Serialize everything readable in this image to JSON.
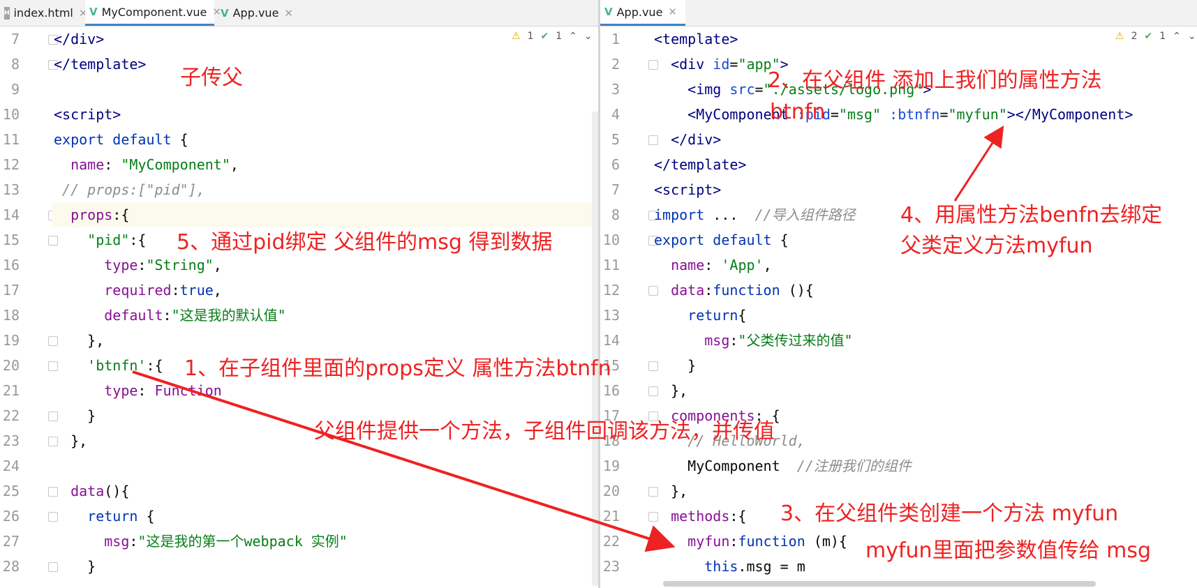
{
  "left": {
    "tabs": [
      {
        "label": "index.html",
        "icon": "html-file-icon",
        "active": false
      },
      {
        "label": "MyComponent.vue",
        "icon": "vue-file-icon",
        "active": true
      },
      {
        "label": "App.vue",
        "icon": "vue-file-icon",
        "active": false
      }
    ],
    "status": {
      "warnings": "1",
      "ok": "1"
    },
    "lines": [
      {
        "n": "7",
        "tokens": [
          [
            "tag",
            "</div>"
          ]
        ]
      },
      {
        "n": "8",
        "tokens": [
          [
            "tag",
            "</template>"
          ]
        ]
      },
      {
        "n": "9",
        "tokens": []
      },
      {
        "n": "10",
        "tokens": [
          [
            "tag",
            "<script>"
          ]
        ]
      },
      {
        "n": "11",
        "tokens": [
          [
            "kw",
            "export default "
          ],
          [
            "plain",
            "{"
          ]
        ]
      },
      {
        "n": "12",
        "tokens": [
          [
            "plain",
            "  "
          ],
          [
            "prop",
            "name"
          ],
          [
            "plain",
            ": "
          ],
          [
            "str",
            "\"MyComponent\""
          ],
          [
            "plain",
            ","
          ]
        ]
      },
      {
        "n": "13",
        "tokens": [
          [
            "cmt",
            " // props:[\"pid\"],"
          ]
        ]
      },
      {
        "n": "14",
        "tokens": [
          [
            "plain",
            "  "
          ],
          [
            "prop",
            "props"
          ],
          [
            "plain",
            ":{"
          ]
        ]
      },
      {
        "n": "15",
        "tokens": [
          [
            "plain",
            "    "
          ],
          [
            "str",
            "\"pid\""
          ],
          [
            "plain",
            ":{"
          ]
        ]
      },
      {
        "n": "16",
        "tokens": [
          [
            "plain",
            "      "
          ],
          [
            "prop",
            "type"
          ],
          [
            "plain",
            ":"
          ],
          [
            "str",
            "\"String\""
          ],
          [
            "plain",
            ","
          ]
        ]
      },
      {
        "n": "17",
        "tokens": [
          [
            "plain",
            "      "
          ],
          [
            "prop",
            "required"
          ],
          [
            "plain",
            ":"
          ],
          [
            "kw",
            "true"
          ],
          [
            "plain",
            ","
          ]
        ]
      },
      {
        "n": "18",
        "tokens": [
          [
            "plain",
            "      "
          ],
          [
            "prop",
            "default"
          ],
          [
            "plain",
            ":"
          ],
          [
            "str",
            "\"这是我的默认值\""
          ]
        ]
      },
      {
        "n": "19",
        "tokens": [
          [
            "plain",
            "    },"
          ]
        ]
      },
      {
        "n": "20",
        "tokens": [
          [
            "plain",
            "    "
          ],
          [
            "str",
            "'btnfn'"
          ],
          [
            "plain",
            ":{"
          ]
        ]
      },
      {
        "n": "21",
        "tokens": [
          [
            "plain",
            "      "
          ],
          [
            "prop",
            "type"
          ],
          [
            "plain",
            ": "
          ],
          [
            "prop",
            "Function"
          ]
        ]
      },
      {
        "n": "22",
        "tokens": [
          [
            "plain",
            "    }"
          ]
        ]
      },
      {
        "n": "23",
        "tokens": [
          [
            "plain",
            "  },"
          ]
        ]
      },
      {
        "n": "24",
        "tokens": []
      },
      {
        "n": "25",
        "tokens": [
          [
            "plain",
            "  "
          ],
          [
            "prop",
            "data"
          ],
          [
            "plain",
            "(){"
          ]
        ]
      },
      {
        "n": "26",
        "tokens": [
          [
            "plain",
            "    "
          ],
          [
            "kw",
            "return "
          ],
          [
            "plain",
            "{"
          ]
        ]
      },
      {
        "n": "27",
        "tokens": [
          [
            "plain",
            "      "
          ],
          [
            "prop",
            "msg"
          ],
          [
            "plain",
            ":"
          ],
          [
            "str",
            "\"这是我的第一个webpack 实例\""
          ]
        ]
      },
      {
        "n": "28",
        "tokens": [
          [
            "plain",
            "    }"
          ]
        ]
      }
    ]
  },
  "right": {
    "tabs": [
      {
        "label": "App.vue",
        "icon": "vue-file-icon",
        "active": true
      }
    ],
    "status": {
      "warnings": "2",
      "ok": "1"
    },
    "lines": [
      {
        "n": "1",
        "tokens": [
          [
            "tag",
            "<template>"
          ]
        ]
      },
      {
        "n": "2",
        "tokens": [
          [
            "tag",
            "  <div "
          ],
          [
            "attr",
            "id"
          ],
          [
            "plain",
            "="
          ],
          [
            "str",
            "\"app\""
          ],
          [
            "tag",
            ">"
          ]
        ]
      },
      {
        "n": "3",
        "tokens": [
          [
            "tag",
            "    <img "
          ],
          [
            "attr",
            "src"
          ],
          [
            "plain",
            "="
          ],
          [
            "str",
            "\"./assets/logo.png\""
          ],
          [
            "tag",
            ">"
          ]
        ]
      },
      {
        "n": "4",
        "tokens": [
          [
            "tag",
            "    <MyComponent "
          ],
          [
            "attr",
            ":pid"
          ],
          [
            "plain",
            "="
          ],
          [
            "str",
            "\"msg\""
          ],
          [
            "attr",
            " :btnfn"
          ],
          [
            "plain",
            "="
          ],
          [
            "str",
            "\"myfun\""
          ],
          [
            "tag",
            "></MyComponent>"
          ]
        ]
      },
      {
        "n": "5",
        "tokens": [
          [
            "tag",
            "  </div>"
          ]
        ]
      },
      {
        "n": "6",
        "tokens": [
          [
            "tag",
            "</template>"
          ]
        ]
      },
      {
        "n": "7",
        "tokens": [
          [
            "tag",
            "<script>"
          ]
        ]
      },
      {
        "n": "8",
        "tokens": [
          [
            "kw",
            "import "
          ],
          [
            "plain",
            "...  "
          ],
          [
            "cmt",
            "//导入组件路径"
          ]
        ]
      },
      {
        "n": "10",
        "tokens": [
          [
            "kw",
            "export default "
          ],
          [
            "plain",
            "{"
          ]
        ]
      },
      {
        "n": "11",
        "tokens": [
          [
            "plain",
            "  "
          ],
          [
            "prop",
            "name"
          ],
          [
            "plain",
            ": "
          ],
          [
            "str",
            "'App'"
          ],
          [
            "plain",
            ","
          ]
        ]
      },
      {
        "n": "12",
        "tokens": [
          [
            "plain",
            "  "
          ],
          [
            "prop",
            "data"
          ],
          [
            "plain",
            ":"
          ],
          [
            "kw",
            "function "
          ],
          [
            "plain",
            "(){"
          ]
        ]
      },
      {
        "n": "13",
        "tokens": [
          [
            "plain",
            "    "
          ],
          [
            "kw",
            "return"
          ],
          [
            "plain",
            "{"
          ]
        ]
      },
      {
        "n": "14",
        "tokens": [
          [
            "plain",
            "      "
          ],
          [
            "prop",
            "msg"
          ],
          [
            "plain",
            ":"
          ],
          [
            "str",
            "\"父类传过来的值\""
          ]
        ]
      },
      {
        "n": "15",
        "tokens": [
          [
            "plain",
            "    }"
          ]
        ]
      },
      {
        "n": "16",
        "tokens": [
          [
            "plain",
            "  },"
          ]
        ]
      },
      {
        "n": "17",
        "tokens": [
          [
            "plain",
            "  "
          ],
          [
            "prop",
            "components"
          ],
          [
            "plain",
            ": {"
          ]
        ]
      },
      {
        "n": "18",
        "tokens": [
          [
            "cmt",
            "    // HelloWorld,"
          ]
        ]
      },
      {
        "n": "19",
        "tokens": [
          [
            "plain",
            "    MyComponent  "
          ],
          [
            "cmt",
            "//注册我们的组件"
          ]
        ]
      },
      {
        "n": "20",
        "tokens": [
          [
            "plain",
            "  },"
          ]
        ]
      },
      {
        "n": "21",
        "tokens": [
          [
            "plain",
            "  "
          ],
          [
            "prop",
            "methods"
          ],
          [
            "plain",
            ":{"
          ]
        ]
      },
      {
        "n": "22",
        "tokens": [
          [
            "plain",
            "    "
          ],
          [
            "prop",
            "myfun"
          ],
          [
            "plain",
            ":"
          ],
          [
            "kw",
            "function "
          ],
          [
            "plain",
            "(m){"
          ]
        ]
      },
      {
        "n": "23",
        "tokens": [
          [
            "plain",
            "      "
          ],
          [
            "kw",
            "this"
          ],
          [
            "plain",
            ".msg = m"
          ]
        ]
      }
    ]
  },
  "annotations": {
    "a_title": "子传父",
    "a1": "1、在子组件里面的props定义 属性方法btnfn",
    "a2a": "2、在父组件 添加上我们的属性方法",
    "a2b": "btnfn",
    "a3a": "3、在父组件类创建一个方法 myfun",
    "a3b": "myfun里面把参数值传给 msg",
    "a4a": "4、用属性方法benfn去绑定",
    "a4b": "父类定义方法myfun",
    "a5": "5、通过pid绑定 父组件的msg 得到数据",
    "a_middle": "父组件提供一个方法，子组件回调该方法，并传值"
  },
  "colors": {
    "annotation": "#ee2222",
    "tab_accent": "#4083c9"
  }
}
